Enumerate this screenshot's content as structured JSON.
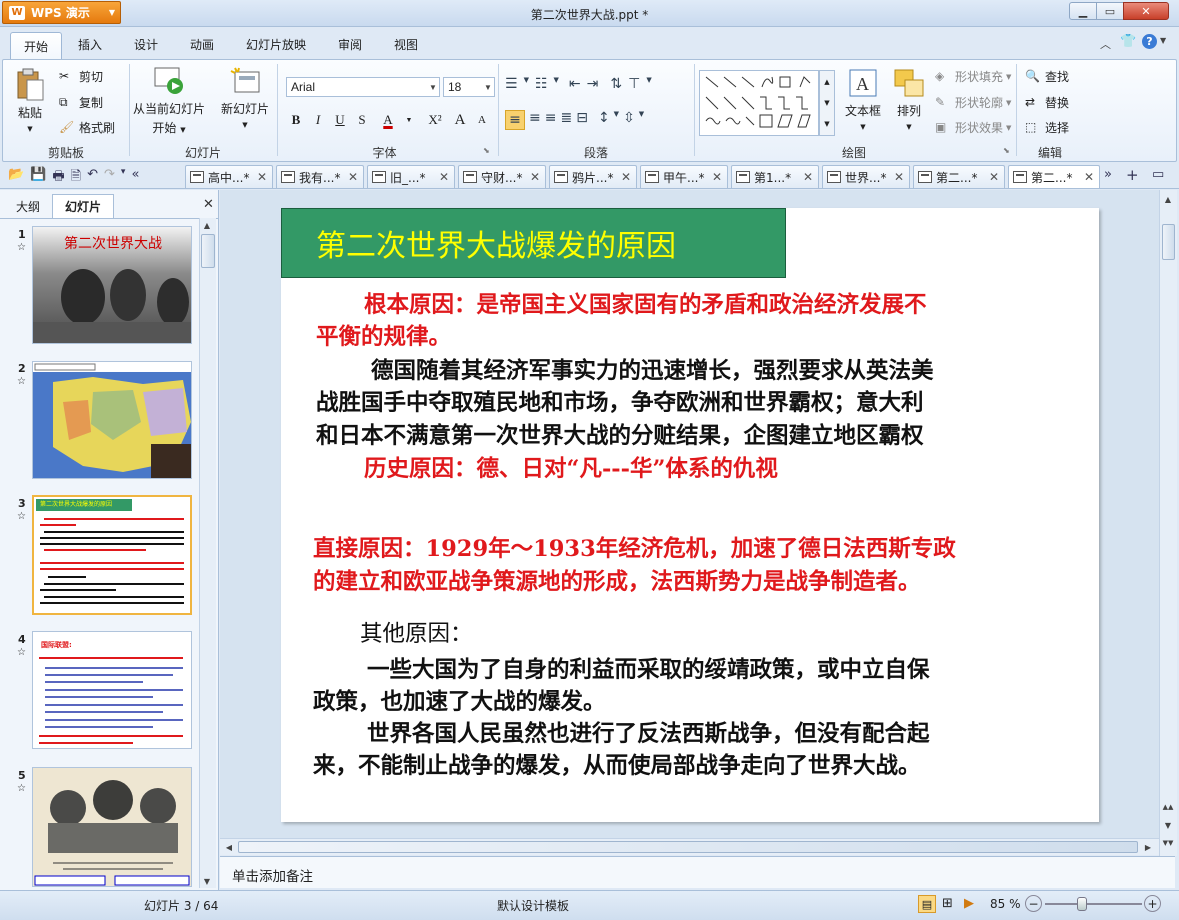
{
  "app": {
    "name": "WPS 演示",
    "logo": "W",
    "doc_title": "第二次世界大战.ppt *"
  },
  "menu": {
    "tabs": [
      "开始",
      "插入",
      "设计",
      "动画",
      "幻灯片放映",
      "审阅",
      "视图"
    ]
  },
  "ribbon": {
    "clipboard": {
      "paste": "粘贴",
      "cut": "剪切",
      "copy": "复制",
      "format_painter": "格式刷",
      "label": "剪贴板"
    },
    "slides": {
      "from_current": "从当前幻灯片",
      "start": "开始",
      "new_slide": "新幻灯片",
      "label": "幻灯片"
    },
    "font": {
      "family": "Arial",
      "size": "18",
      "label": "字体",
      "bold": "B",
      "italic": "I",
      "underline": "U",
      "shadow": "S",
      "color": "A",
      "superscript": "X²",
      "grow": "A",
      "shrink": "A"
    },
    "paragraph": {
      "label": "段落"
    },
    "drawing": {
      "textbox": "文本框",
      "arrange": "排列",
      "shape_fill": "形状填充",
      "shape_outline": "形状轮廓",
      "shape_effect": "形状效果",
      "label": "绘图"
    },
    "edit": {
      "find": "查找",
      "replace": "替换",
      "select": "选择",
      "label": "编辑"
    }
  },
  "doc_tabs": [
    "高中...*",
    "我有...*",
    "旧_...*",
    "守财...*",
    "鸦片...*",
    "甲午...*",
    "第1...*",
    "世界...*",
    "第二...*",
    "第二...*"
  ],
  "left_panel": {
    "tab_outline": "大纲",
    "tab_slides": "幻灯片"
  },
  "thumbnails": [
    {
      "num": "1",
      "title": "第二次世界大战"
    },
    {
      "num": "2"
    },
    {
      "num": "3",
      "title": "第二次世界大战爆发的原因"
    },
    {
      "num": "4",
      "title": "国际联盟:"
    },
    {
      "num": "5"
    }
  ],
  "slide": {
    "title": "第二次世界大战爆发的原因",
    "p1": "根本原因：是帝国主义国家固有的矛盾和政治经济发展不",
    "p1b": "平衡的规律。",
    "p2": "德国随着其经济军事实力的迅速增长，强烈要求从英法美",
    "p2b": "战胜国手中夺取殖民地和市场，争夺欧洲和世界霸权；意大利",
    "p2c": "和日本不满意第一次世界大战的分赃结果，企图建立地区霸权",
    "p3": "历史原因：德、日对“凡---华”体系的仇视",
    "p4": "直接原因：1929年～1933年经济危机，加速了德日法西斯专政",
    "p4b": "的建立和欧亚战争策源地的形成，法西斯势力是战争制造者。",
    "p5": "其他原因：",
    "p6": "一些大国为了自身的利益而采取的绥靖政策，或中立自保",
    "p6b": "政策，也加速了大战的爆发。",
    "p7": "世界各国人民虽然也进行了反法西斯战争，但没有配合起",
    "p7b": "来，不能制止战争的爆发，从而使局部战争走向了世界大战。"
  },
  "notes": {
    "placeholder": "单击添加备注"
  },
  "status": {
    "slide_pos": "幻灯片 3 / 64",
    "template": "默认设计模板",
    "zoom": "85 %"
  },
  "colors": {
    "title_bg": "#339966",
    "title_text": "#ffff00",
    "red_text": "#e0191c",
    "accent": "#e57a0e"
  }
}
